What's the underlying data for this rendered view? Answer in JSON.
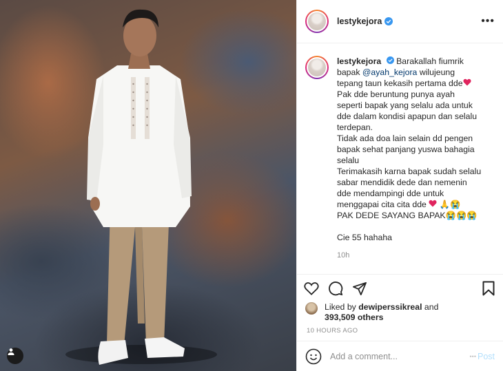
{
  "post": {
    "username": "lestykejora",
    "caption_lines": [
      "Barakallah fiumrik",
      "bapak ",
      "tepang taun kekasih pertama dde",
      "Pak dde beruntung punya ayah",
      "seperti bapak yang selalu ada untuk",
      "dde dalam kondisi apapun dan selalu",
      "terdepan.",
      "Tidak ada doa lain selain dd pengen",
      "bapak sehat panjang yuswa bahagia",
      "selalu",
      "Terimakasih karna bapak sudah selalu",
      "sabar mendidik dede dan nemenin",
      "dde mendampingi dde untuk",
      "menggapai cita cita dde ",
      "PAK DEDE SAYANG BAPAK",
      "Cie 55 hahaha"
    ],
    "mention": "@ayah_kejora",
    "mention_suffix": " wilujeung",
    "caption_time": "10h",
    "liked_by_prefix": "Liked by ",
    "liked_by_user": "dewiperssikreal",
    "liked_by_and": " and",
    "likes_count": "393,509 others",
    "timestamp": "10 HOURS AGO",
    "comment_placeholder": "Add a comment...",
    "post_label": "Post"
  },
  "icons": {
    "more": "more-dots-icon",
    "verified": "verified-badge-icon",
    "like": "heart-icon",
    "comment": "comment-icon",
    "share": "share-icon",
    "save": "bookmark-icon",
    "emoji": "emoji-icon",
    "tags": "user-tag-icon"
  },
  "colors": {
    "verified": "#3897f0",
    "mention": "#00376b",
    "post_disabled": "#b2dffc",
    "heart_emoji": "#e0245e"
  }
}
